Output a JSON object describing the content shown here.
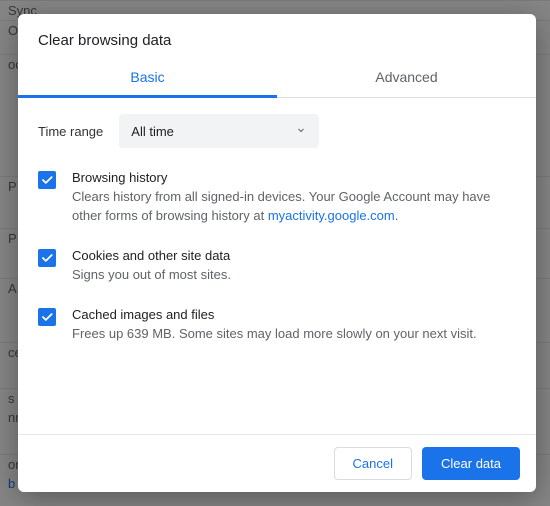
{
  "background": {
    "rows": [
      "Sync",
      "O",
      "oo",
      "P",
      "P",
      "A",
      "ce",
      "s",
      "nro",
      "ome",
      "b p"
    ]
  },
  "dialog": {
    "title": "Clear browsing data",
    "tabs": {
      "basic": "Basic",
      "advanced": "Advanced",
      "active": "basic"
    },
    "time_range_label": "Time range",
    "time_range_value": "All time",
    "options": [
      {
        "checked": true,
        "title": "Browsing history",
        "desc_before": "Clears history from all signed-in devices. Your Google Account may have other forms of browsing history at ",
        "link_text": "myactivity.google.com",
        "desc_after": "."
      },
      {
        "checked": true,
        "title": "Cookies and other site data",
        "desc_before": "Signs you out of most sites.",
        "link_text": "",
        "desc_after": ""
      },
      {
        "checked": true,
        "title": "Cached images and files",
        "desc_before": "Frees up 639 MB. Some sites may load more slowly on your next visit.",
        "link_text": "",
        "desc_after": ""
      }
    ],
    "buttons": {
      "cancel": "Cancel",
      "confirm": "Clear data"
    }
  }
}
